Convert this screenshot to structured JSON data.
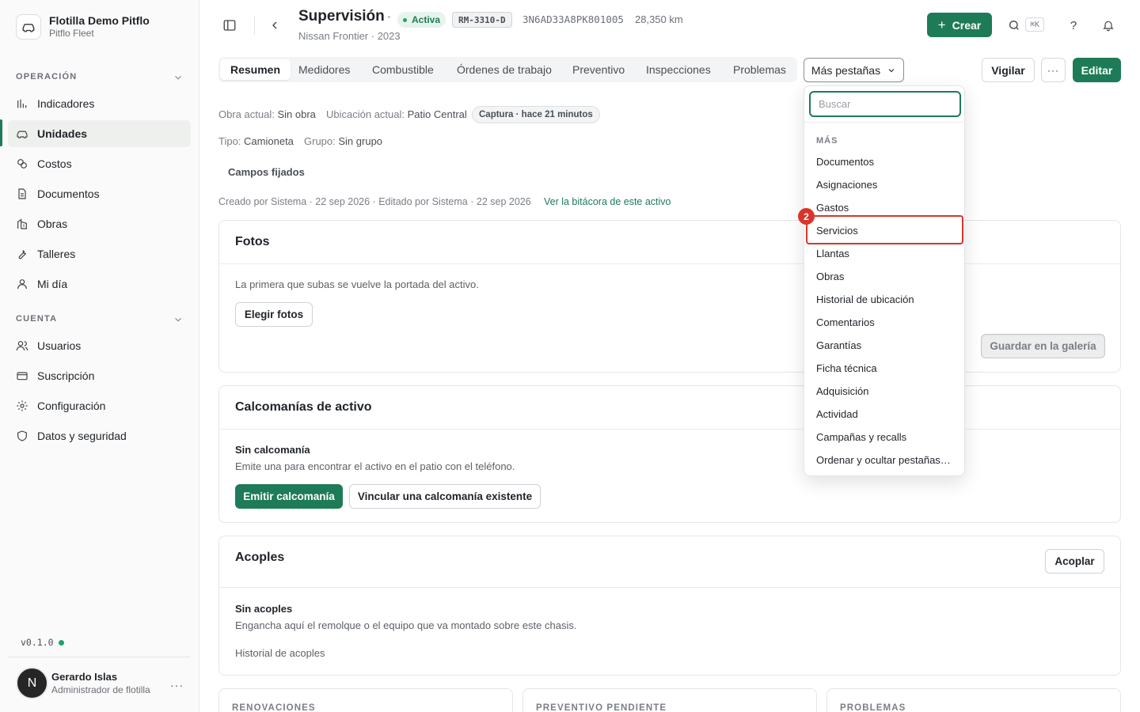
{
  "sidebar": {
    "org_name": "Flotilla Demo Pitflo",
    "org_sub": "Pitflo Fleet",
    "section_operacion": "OPERACIÓN",
    "section_cuenta": "CUENTA",
    "operacion_items": [
      {
        "label": "Indicadores",
        "icon": "chart-icon"
      },
      {
        "label": "Unidades",
        "icon": "car-icon"
      },
      {
        "label": "Costos",
        "icon": "coins-icon"
      },
      {
        "label": "Documentos",
        "icon": "document-icon"
      },
      {
        "label": "Obras",
        "icon": "building-icon"
      },
      {
        "label": "Talleres",
        "icon": "wrench-icon"
      },
      {
        "label": "Mi día",
        "icon": "user-icon"
      }
    ],
    "cuenta_items": [
      {
        "label": "Usuarios",
        "icon": "users-icon"
      },
      {
        "label": "Suscripción",
        "icon": "card-icon"
      },
      {
        "label": "Configuración",
        "icon": "gear-icon"
      },
      {
        "label": "Datos y seguridad",
        "icon": "shield-icon"
      }
    ],
    "version": "v0.1.0",
    "user": {
      "initial": "N",
      "name": "Gerardo Islas",
      "role": "Administrador de flotilla"
    }
  },
  "header": {
    "title": "Supervisión",
    "status": "Activa",
    "plate": "RM-3310-D",
    "vin": "3N6AD33A8PK801005",
    "km": "28,350 km",
    "subtitle": "Nissan Frontier · 2023",
    "create_label": "Crear",
    "shortcut": "⌘K",
    "help": "?"
  },
  "tabs": [
    "Resumen",
    "Medidores",
    "Combustible",
    "Órdenes de trabajo",
    "Preventivo",
    "Inspecciones",
    "Problemas"
  ],
  "more_tabs_label": "Más pestañas",
  "actions": {
    "watch": "Vigilar",
    "more": "···",
    "edit": "Editar"
  },
  "meta": {
    "obra_label": "Obra actual:",
    "obra_value": "Sin obra",
    "ubicacion_label": "Ubicación actual:",
    "ubicacion_value": "Patio Central",
    "capture": "Captura · hace 21 minutos",
    "tipo_label": "Tipo:",
    "tipo_value": "Camioneta",
    "grupo_label": "Grupo:",
    "grupo_value": "Sin grupo",
    "pinned": "Campos fijados",
    "created": "Creado por Sistema · 22 sep 2026 · Editado por Sistema · 22 sep 2026",
    "log_link": "Ver la bitácora de este activo"
  },
  "photos": {
    "title": "Fotos",
    "text": "La primera que subas se vuelve la portada del activo.",
    "choose": "Elegir fotos",
    "save": "Guardar en la galería"
  },
  "decals": {
    "title": "Calcomanías de activo",
    "none": "Sin calcomanía",
    "text": "Emite una para encontrar el activo en el patio con el teléfono.",
    "emit": "Emitir calcomanía",
    "link": "Vincular una calcomanía existente"
  },
  "couplings": {
    "title": "Acoples",
    "couple": "Acoplar",
    "none": "Sin acoples",
    "text": "Engancha aquí el remolque o el equipo que va montado sobre este chasis.",
    "history": "Historial de acoples"
  },
  "stats": [
    "RENOVACIONES",
    "PREVENTIVO PENDIENTE",
    "PROBLEMAS"
  ],
  "dropdown": {
    "search_placeholder": "Buscar",
    "section": "MÁS",
    "items": [
      "Documentos",
      "Asignaciones",
      "Gastos",
      "Servicios",
      "Llantas",
      "Obras",
      "Historial de ubicación",
      "Comentarios",
      "Garantías",
      "Ficha técnica",
      "Adquisición",
      "Actividad",
      "Campañas y recalls",
      "Ordenar y ocultar pestañas…"
    ],
    "highlighted_index": 3,
    "step_number": "2"
  },
  "colors": {
    "accent": "#1e7b57",
    "highlight": "#d9342b"
  }
}
